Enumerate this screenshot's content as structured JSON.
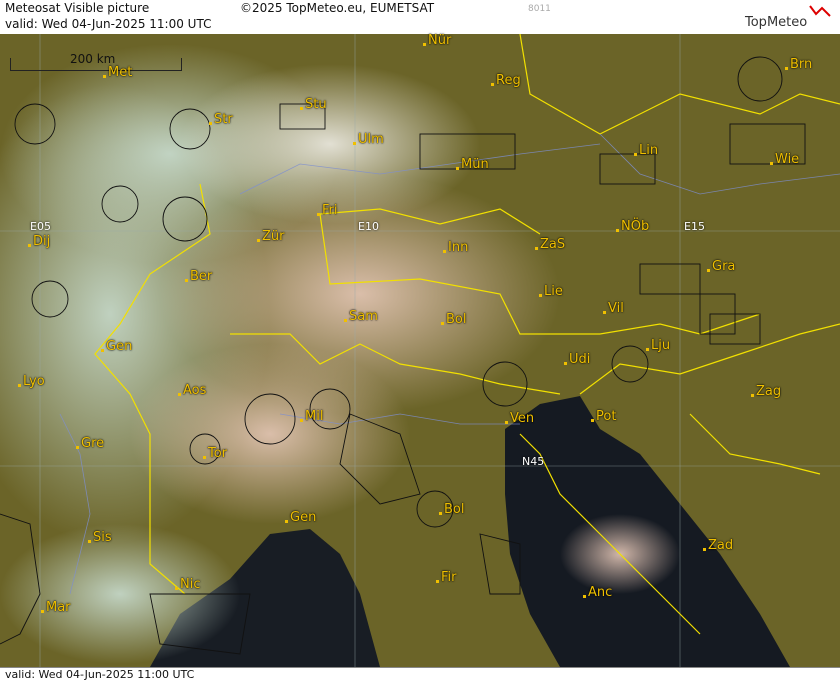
{
  "header": {
    "title": "Meteosat Visible picture",
    "valid": "valid:  Wed  04-Jun-2025  11:00 UTC",
    "copyright": "©2025 TopMeteo.eu, EUMETSAT",
    "code": "8011",
    "logo": "TopMeteo"
  },
  "footer": {
    "valid": "valid:  Wed  04-Jun-2025  11:00 UTC"
  },
  "scale": {
    "label": "200 km"
  },
  "grid_labels": [
    "E05",
    "E10",
    "E15",
    "N45"
  ],
  "cities": [
    "Nür",
    "Brn",
    "Reg",
    "Met",
    "Stu",
    "Str",
    "Ulm",
    "Lin",
    "Wie",
    "Mün",
    "Fri",
    "Zür",
    "Dij",
    "Inn",
    "ZaS",
    "NÖb",
    "Ber",
    "Gra",
    "Lie",
    "Sam",
    "Bol",
    "Vil",
    "Gen",
    "Lju",
    "Lyo",
    "Udi",
    "Aos",
    "Zag",
    "Mil",
    "Ven",
    "Pot",
    "Gre",
    "Tor",
    "Gen",
    "Bol",
    "Sis",
    "Zad",
    "Fir",
    "Nic",
    "Anc",
    "Mar"
  ]
}
